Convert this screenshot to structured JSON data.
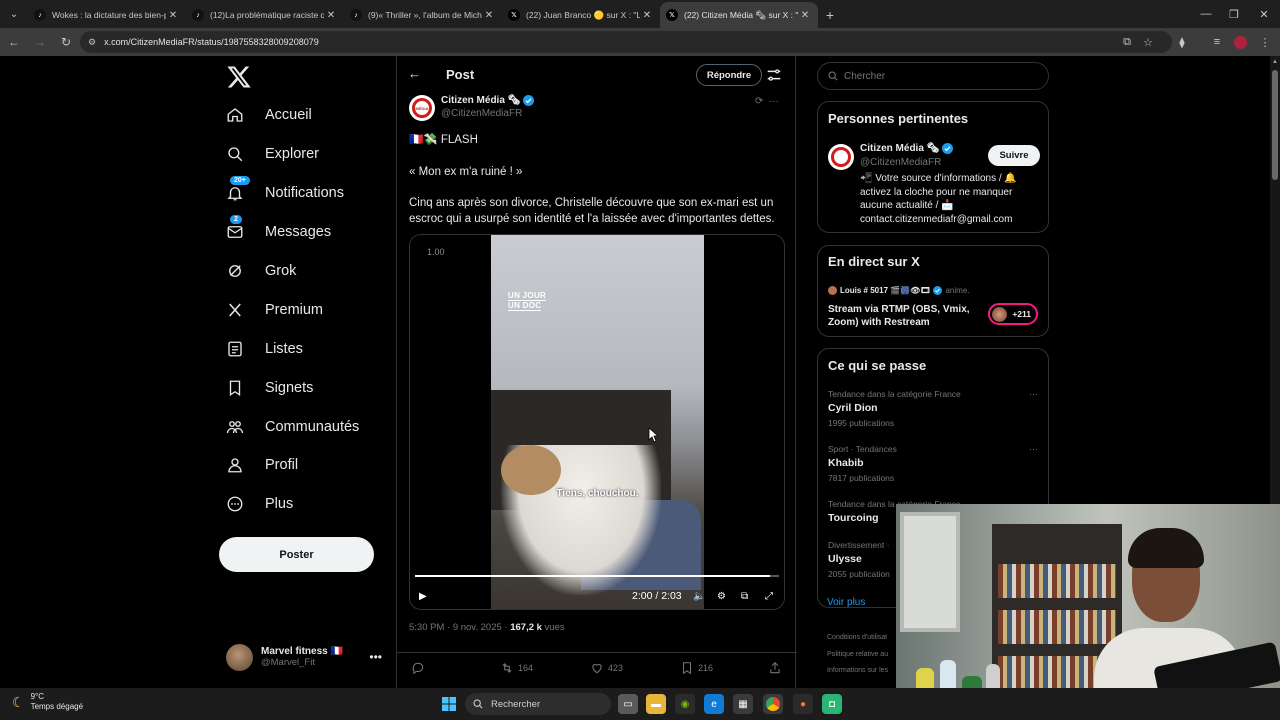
{
  "browser": {
    "tabs": [
      {
        "title": "Wokes : la dictature des bien-pe",
        "icon": "tiktok-icon",
        "active": false
      },
      {
        "title": "(12)La problématique raciste de",
        "icon": "tiktok-icon",
        "active": false
      },
      {
        "title": "(9)« Thriller », l'album de Micha",
        "icon": "tiktok-icon",
        "active": false
      },
      {
        "title": "(22) Juan Branco 🟡 sur X : \"La",
        "icon": "x-icon",
        "active": false
      },
      {
        "title": "(22) Citizen Média 🗞 sur X : \"\"",
        "icon": "x-icon",
        "active": true
      }
    ],
    "url": "x.com/CitizenMediaFR/status/1987558328009208079"
  },
  "nav": {
    "items": [
      {
        "label": "Accueil",
        "icon": "home-icon",
        "badge": ""
      },
      {
        "label": "Explorer",
        "icon": "search-icon",
        "badge": ""
      },
      {
        "label": "Notifications",
        "icon": "bell-icon",
        "badge": "20+"
      },
      {
        "label": "Messages",
        "icon": "mail-icon",
        "badge": "2"
      },
      {
        "label": "Grok",
        "icon": "grok-icon",
        "badge": ""
      },
      {
        "label": "Premium",
        "icon": "x-premium-icon",
        "badge": ""
      },
      {
        "label": "Listes",
        "icon": "list-icon",
        "badge": ""
      },
      {
        "label": "Signets",
        "icon": "bookmark-icon",
        "badge": ""
      },
      {
        "label": "Communautés",
        "icon": "communities-icon",
        "badge": ""
      },
      {
        "label": "Profil",
        "icon": "profile-icon",
        "badge": ""
      },
      {
        "label": "Plus",
        "icon": "more-circle-icon",
        "badge": ""
      }
    ],
    "post_button": "Poster",
    "account": {
      "name": "Marvel fitness 🇫🇷",
      "handle": "@Marvel_Fit"
    }
  },
  "post": {
    "header_title": "Post",
    "reply_button": "Répondre",
    "author": {
      "name": "Citizen Média 🗞",
      "handle": "@CitizenMediaFR",
      "avatar_text": "MÉDIA"
    },
    "lines": [
      "🇫🇷💸 FLASH",
      "« Mon ex m'a ruiné ! »",
      "Cinq ans après son divorce, Christelle découvre que son ex-mari est un escroc qui a usurpé son identité et l'a laissée avec d'importantes dettes."
    ],
    "video": {
      "rate": "1.00",
      "logo_line1": "UN JOUR",
      "logo_line2": "UN DOC",
      "subtitle": "Tiens, chouchou.",
      "time": "2:00 / 2:03",
      "progress": 0.976
    },
    "meta_time": "5:30 PM · 9 nov. 2025 · ",
    "views_count": "167,2 k",
    "views_label": " vues",
    "stats": {
      "retweets": "164",
      "likes": "423",
      "bookmarks": "216"
    }
  },
  "sidebar": {
    "search_placeholder": "Chercher",
    "relevant": {
      "title": "Personnes pertinentes",
      "name": "Citizen Média 🗞",
      "handle": "@CitizenMediaFR",
      "follow": "Suivre",
      "bio": "📲 Votre source d'informations / 🔔 activez la cloche pour ne manquer aucune actualité / 📩 contact.citizenmediafr@gmail.com"
    },
    "live": {
      "title": "En direct sur X",
      "host": "Louis # 5017 🎬🎆👁🎞",
      "host_suffix": "anime.",
      "stream_title": "Stream via RTMP (OBS, Vmix, Zoom) with Restream",
      "viewers": "+211"
    },
    "trends": {
      "title": "Ce qui se passe",
      "items": [
        {
          "context": "Tendance dans la catégorie France",
          "topic": "Cyril Dion",
          "count": "1995 publications"
        },
        {
          "context": "Sport · Tendances",
          "topic": "Khabib",
          "count": "7817 publications"
        },
        {
          "context": "Tendance dans la catégorie France",
          "topic": "Tourcoing",
          "count": ""
        },
        {
          "context": "Divertissement ·",
          "topic": "Ulysse",
          "count": "2055 publication"
        }
      ],
      "see_more": "Voir plus"
    },
    "footer": [
      "Conditions d'utilisat",
      "Politique relative au",
      "Informations sur les"
    ]
  },
  "taskbar": {
    "weather_temp": "9°C",
    "weather_desc": "Temps dégagé",
    "search": "Rechercher"
  }
}
